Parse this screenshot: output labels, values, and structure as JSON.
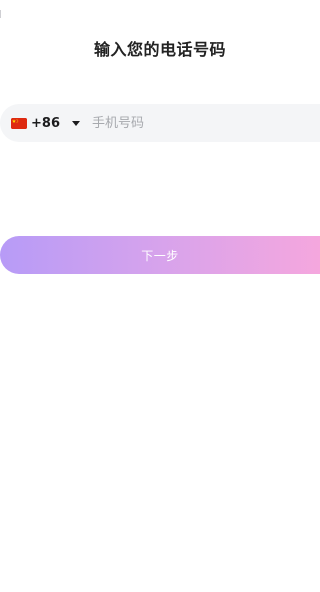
{
  "page": {
    "title": "输入您的电话号码"
  },
  "phone": {
    "flag_icon": "china-flag-icon",
    "country_code": "+86",
    "dropdown_icon": "caret-down-icon",
    "value": "",
    "placeholder": "手机号码"
  },
  "actions": {
    "next_label": "下一步"
  },
  "colors": {
    "button_gradient_start": "#b79bf7",
    "button_gradient_end": "#f5a7de",
    "input_background": "#f4f5f7",
    "flag_red": "#de2910",
    "flag_yellow": "#ffde00"
  }
}
